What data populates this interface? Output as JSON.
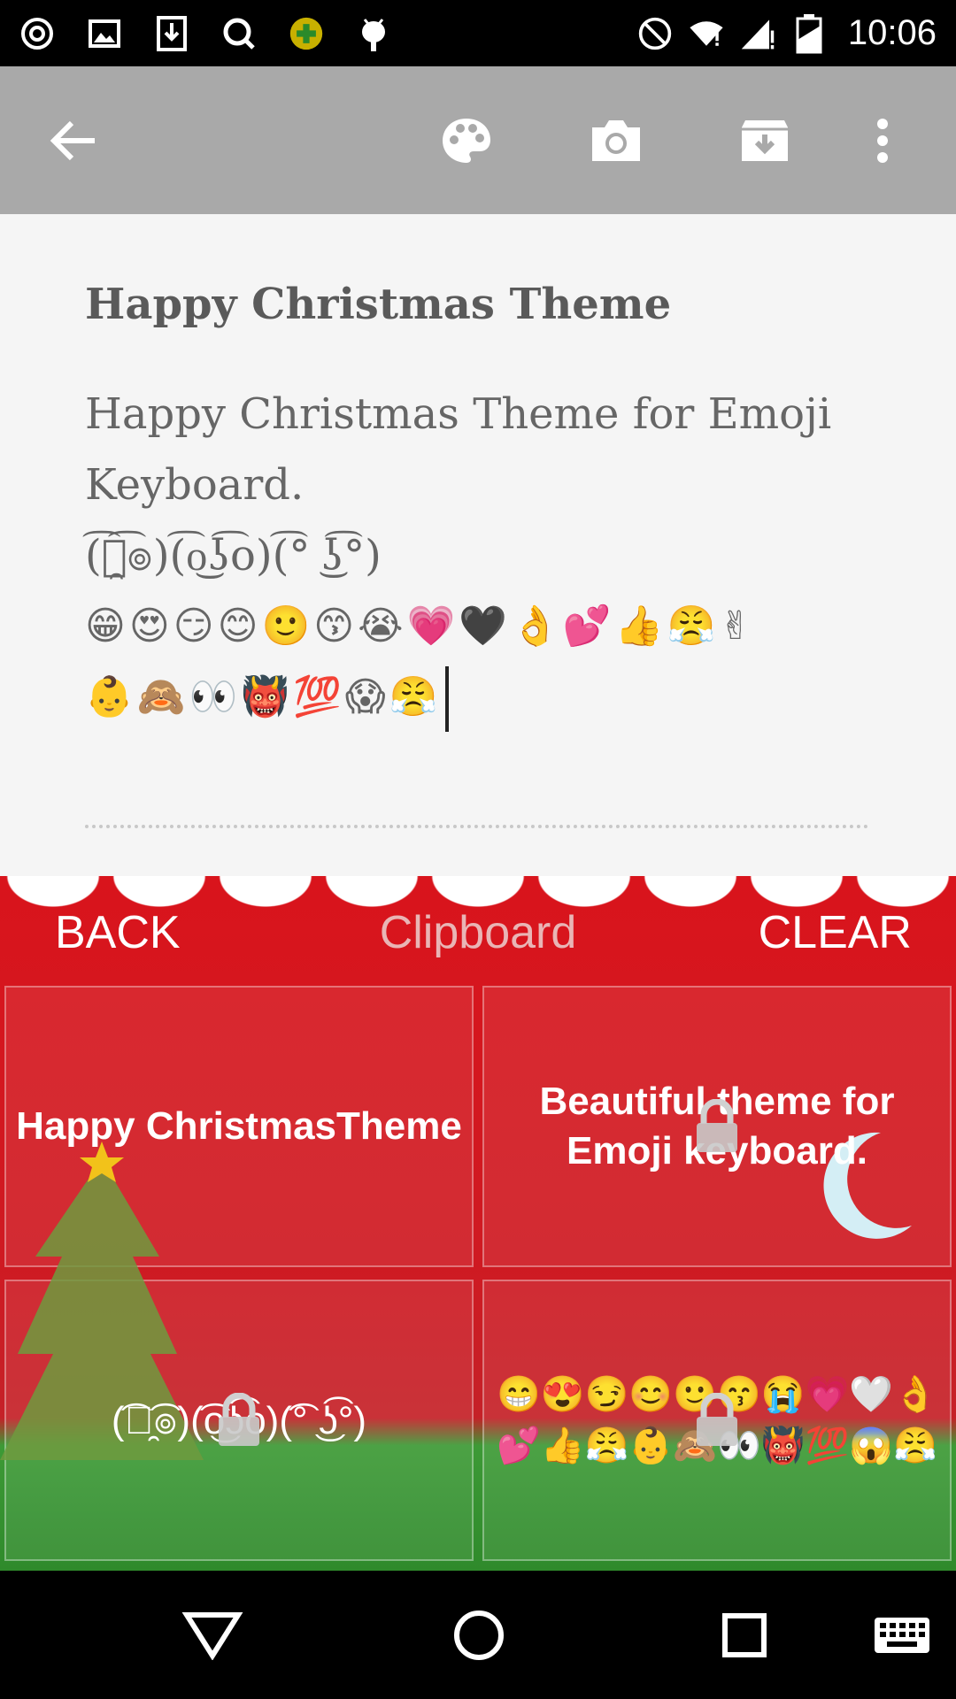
{
  "status_bar": {
    "time": "10:06",
    "left_icons": [
      "instagram-icon",
      "image-icon",
      "download-icon",
      "search-app-icon",
      "game-icon",
      "android-bug-icon"
    ],
    "right_icons": [
      "do-not-disturb-icon",
      "wifi-icon",
      "signal-icon",
      "battery-icon"
    ]
  },
  "toolbar": {
    "icons": [
      "back-arrow-icon",
      "palette-icon",
      "camera-icon",
      "archive-icon",
      "more-vert-icon"
    ]
  },
  "note": {
    "title": "Happy Christmas Theme",
    "body_line1": "Happy Christmas Theme for Emoji",
    "body_line2": "Keyboard.",
    "body_line3": "(͡๏̯͡๏)(͡o͜ʖ͡o)(͡° ͜ʖ͡°)",
    "emoji_line1": "😁😍😏😊🙂😙😭💗🖤👌💕👍😤✌",
    "emoji_line2": "👶🙈👀👹💯😱😤"
  },
  "keyboard": {
    "back_label": "BACK",
    "title": "Clipboard",
    "clear_label": "CLEAR",
    "clips": [
      {
        "text": "Happy ChristmasTheme",
        "locked": false
      },
      {
        "text": "Beautiful theme for Emoji keyboard.",
        "locked": true
      },
      {
        "text": "(͡๏̯͡๏)(͡o͜ʖ͡o)(͡° ͜ʖ͡°)",
        "locked": true
      },
      {
        "text": "😁😍😏😊🙂😙😭💗🤍👌💕👍😤👶🙈👀👹💯😱😤",
        "locked": true
      }
    ],
    "colors": {
      "red": "#d9141c",
      "green": "#2f8a2b"
    }
  },
  "nav": {
    "icons": [
      "back-triangle-icon",
      "home-circle-icon",
      "recents-square-icon",
      "keyboard-icon"
    ]
  }
}
